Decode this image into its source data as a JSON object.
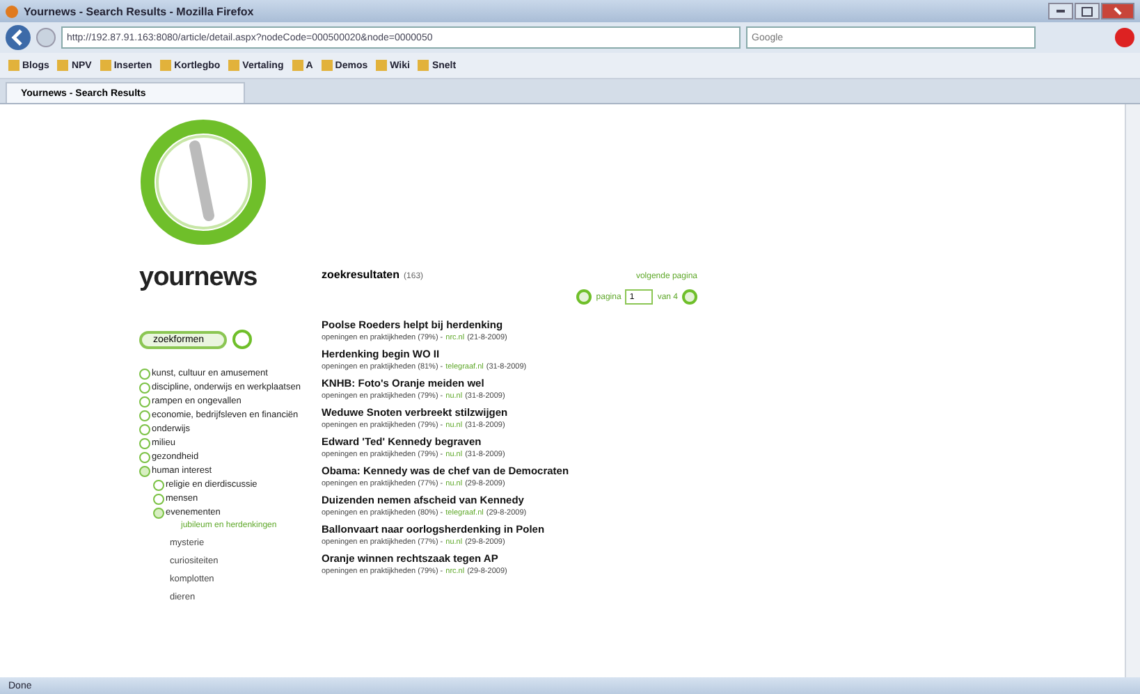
{
  "window": {
    "title": "Yournews - Search Results - Mozilla Firefox"
  },
  "address_bar": {
    "url": "http://192.87.91.163:8080/article/detail.aspx?nodeCode=000500020&node=0000050"
  },
  "search_field": {
    "placeholder": "Google"
  },
  "bookmarks": [
    "Blogs",
    "NPV",
    "Inserten",
    "Kortlegbo",
    "Vertaling",
    "A",
    "Demos",
    "Wiki",
    "Snelt"
  ],
  "tabs": [
    {
      "label": "Yournews - Search Results",
      "selected": true
    }
  ],
  "site": {
    "name": "yournews"
  },
  "search_button": {
    "label": "zoekformen"
  },
  "categories": [
    {
      "label": "kunst, cultuur en amusement",
      "expanded": false
    },
    {
      "label": "discipline, onderwijs en werkplaatsen",
      "expanded": false
    },
    {
      "label": "rampen en ongevallen",
      "expanded": false
    },
    {
      "label": "economie, bedrijfsleven en financiën",
      "expanded": false
    },
    {
      "label": "onderwijs",
      "expanded": false
    },
    {
      "label": "milieu",
      "expanded": false
    },
    {
      "label": "gezondheid",
      "expanded": false
    },
    {
      "label": "human interest",
      "expanded": true,
      "children": [
        {
          "label": "religie en dierdiscussie",
          "expanded": false
        },
        {
          "label": "mensen",
          "expanded": false
        },
        {
          "label": "evenementen",
          "expanded": true,
          "children": [
            {
              "label": "jubileum en herdenkingen",
              "selected": true
            }
          ]
        }
      ]
    }
  ],
  "more_categories": [
    "mysterie",
    "curiositeiten",
    "komplotten",
    "dieren"
  ],
  "results": {
    "heading": "zoekresultaten",
    "count": "(163)",
    "next": "volgende pagina",
    "page_label": "pagina",
    "page": "1",
    "of_pages": "van 4",
    "items": [
      {
        "title": "Poolse Roeders helpt bij herdenking",
        "meta": "openingen en praktijkheden (79%) -",
        "source": "nrc.nl",
        "date": "(21-8-2009)"
      },
      {
        "title": "Herdenking begin WO II",
        "meta": "openingen en praktijkheden (81%) -",
        "source": "telegraaf.nl",
        "date": "(31-8-2009)"
      },
      {
        "title": "KNHB: Foto's Oranje meiden wel",
        "meta": "openingen en praktijkheden (79%) -",
        "source": "nu.nl",
        "date": "(31-8-2009)"
      },
      {
        "title": "Weduwe Snoten verbreekt stilzwijgen",
        "meta": "openingen en praktijkheden (79%) -",
        "source": "nu.nl",
        "date": "(31-8-2009)"
      },
      {
        "title": "Edward 'Ted' Kennedy begraven",
        "meta": "openingen en praktijkheden (79%) -",
        "source": "nu.nl",
        "date": "(31-8-2009)"
      },
      {
        "title": "Obama: Kennedy was de chef van de Democraten",
        "meta": "openingen en praktijkheden (77%) -",
        "source": "nu.nl",
        "date": "(29-8-2009)"
      },
      {
        "title": "Duizenden nemen afscheid van Kennedy",
        "meta": "openingen en praktijkheden (80%) -",
        "source": "telegraaf.nl",
        "date": "(29-8-2009)"
      },
      {
        "title": "Ballonvaart naar oorlogsherdenking in Polen",
        "meta": "openingen en praktijkheden (77%) -",
        "source": "nu.nl",
        "date": "(29-8-2009)"
      },
      {
        "title": "Oranje winnen rechtszaak tegen AP",
        "meta": "openingen en praktijkheden (79%) -",
        "source": "nrc.nl",
        "date": "(29-8-2009)"
      }
    ]
  },
  "status_bar": {
    "text": "Done"
  }
}
